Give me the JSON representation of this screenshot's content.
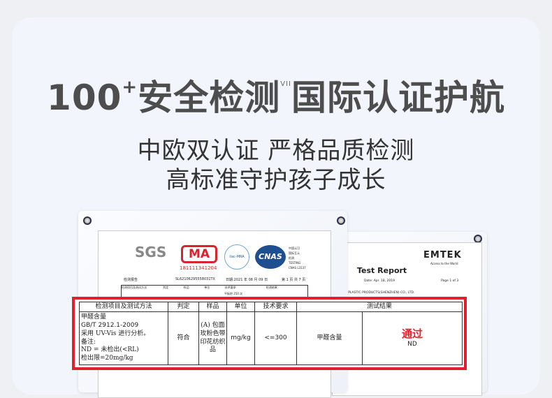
{
  "headline": {
    "number": "100",
    "plus": "+",
    "part1": "安全检测",
    "mark": "VII",
    "part2": "国际认证护航"
  },
  "subtitle": {
    "line1": "中欧双认证 严格品质检测",
    "line2": "高标准守护孩子成长"
  },
  "sgs_report": {
    "logos": {
      "sgs": "SGS",
      "cma": "MA",
      "cma_number": "181111341204",
      "ilac": "ilac-MRA",
      "cnas": "CNAS",
      "cnas_text": [
        "中国认可",
        "国际互认",
        "检测",
        "TESTING",
        "CNAS L3137"
      ]
    },
    "label": "检测报告",
    "report_no": "SL62106295558031TX",
    "date": "日期:2021 年 08 月 09 日",
    "page": "第 1 页 共 7 页",
    "header_cols": [
      "检测项目及测试方法",
      "判定",
      "样品",
      "单位",
      "技术要求",
      "检测结果"
    ],
    "row1": "平板把 250 次"
  },
  "emtek_report": {
    "logo": "EMTEK",
    "tagline": "Access to the World",
    "title": "Test Report",
    "date": "Date: Apr. 18, 2019",
    "page": "Page 1 of 3",
    "company": "XIN HING PLASTIC PRODUCTS(SHENZHEN) CO., LTD."
  },
  "highlight_table": {
    "headers": [
      "检测项目及测试方法",
      "判定",
      "样品",
      "单位",
      "技术要求",
      "测试结果"
    ],
    "item": [
      "甲醛含量",
      "GB/T 2912.1-2009",
      "采用 UV-Vis 进行分析。",
      "备注:",
      "ND = 未检出(<RL)",
      "检出限=20mg/kg"
    ],
    "verdict": "符合",
    "sample": "(A) 包面玫粉色带印花纺织品",
    "unit": "mg/kg",
    "requirement": "<=300",
    "result_item": "甲醛含量",
    "pass": "通过",
    "result": "ND"
  },
  "colors": {
    "accent": "#e0202c",
    "title": "#4d4d4d"
  }
}
